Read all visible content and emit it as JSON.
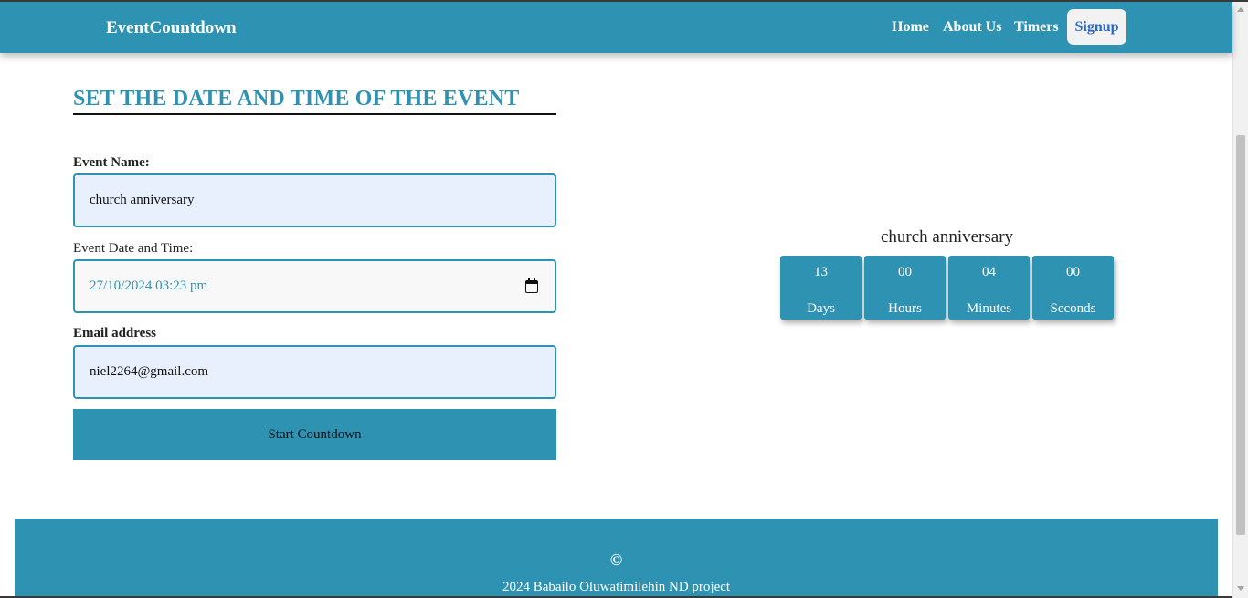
{
  "navbar": {
    "brand": "EventCountdown",
    "links": {
      "home": "Home",
      "about": "About Us",
      "timers": "Timers"
    },
    "signup": "Signup"
  },
  "form": {
    "title": "SET THE DATE AND TIME OF THE EVENT",
    "event_name_label": "Event Name:",
    "event_name_value": "church anniversary",
    "date_label": "Event Date and Time:",
    "date_value": "27/10/2024 03:23  pm",
    "email_label": "Email address",
    "email_value": "niel2264@gmail.com",
    "submit_label": "Start Countdown"
  },
  "countdown": {
    "event_title": "church anniversary",
    "tiles": [
      {
        "value": "13",
        "unit": "Days"
      },
      {
        "value": "00",
        "unit": "Hours"
      },
      {
        "value": "04",
        "unit": "Minutes"
      },
      {
        "value": "00",
        "unit": "Seconds"
      }
    ]
  },
  "footer": {
    "copyright_symbol": "©",
    "text": "2024 Babailo Oluwatimilehin ND project"
  },
  "colors": {
    "primary": "#2e92b3",
    "signup_text": "#2b67c9",
    "autofill_bg": "#e8f0fe"
  }
}
